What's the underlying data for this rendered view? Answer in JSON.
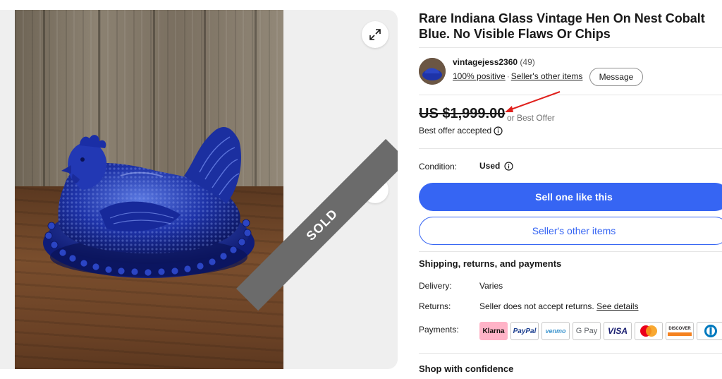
{
  "listing": {
    "title": "Rare Indiana Glass Vintage Hen On Nest Cobalt Blue. No Visible Flaws Or Chips",
    "sold_label": "SOLD"
  },
  "seller": {
    "name": "vintagejess2360",
    "feedback_count": "(49)",
    "positive": "100% positive",
    "other_items": "Seller's other items",
    "message": "Message"
  },
  "price": {
    "amount": "US $1,999.00",
    "best_offer": "or Best Offer",
    "offer_accepted": "Best offer accepted"
  },
  "condition": {
    "label": "Condition:",
    "value": "Used"
  },
  "actions": {
    "sell_one": "Sell one like this",
    "seller_items": "Seller's other items"
  },
  "shipping": {
    "title": "Shipping, returns, and payments",
    "delivery_label": "Delivery:",
    "delivery_value": "Varies",
    "returns_label": "Returns:",
    "returns_value": "Seller does not accept returns.",
    "see_details": "See details",
    "payments_label": "Payments:",
    "methods": [
      "Klarna",
      "PayPal",
      "venmo",
      "G Pay",
      "VISA",
      "",
      "DISCOVER",
      ""
    ]
  },
  "confidence": {
    "title": "Shop with confidence"
  },
  "colors": {
    "accent": "#3665f3",
    "annotation_arrow": "#e0201c",
    "klarna": "#ffb3c7"
  }
}
